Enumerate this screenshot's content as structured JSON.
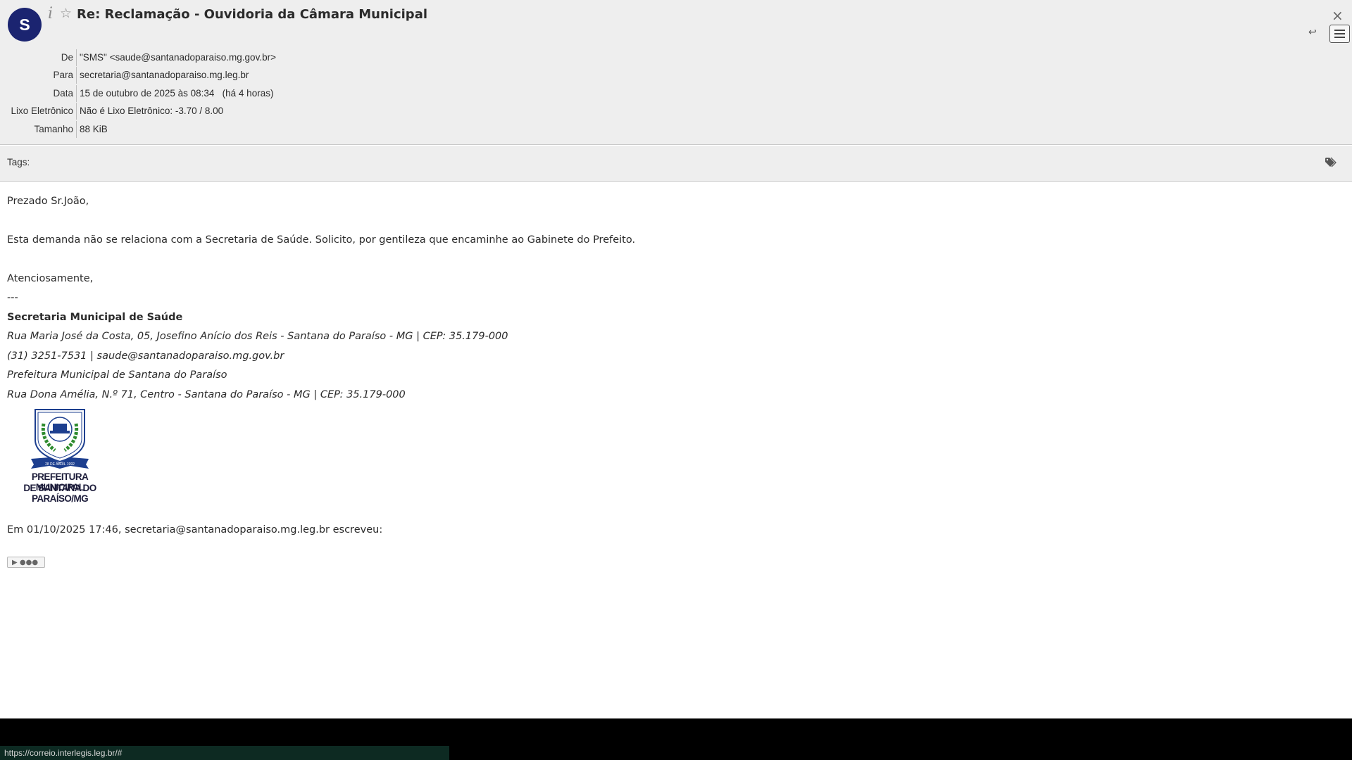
{
  "header": {
    "avatar_letter": "S",
    "info_icon": "info-icon",
    "star_icon": "star-icon",
    "subject": "Re: Reclamação - Ouvidoria da Câmara Municipal",
    "close_glyph": "×",
    "reply_glyph": "↩",
    "fields": [
      {
        "label": "De",
        "value": "\"SMS\" <saude@santanadoparaiso.mg.gov.br>"
      },
      {
        "label": "Para",
        "value": "secretaria@santanadoparaiso.mg.leg.br"
      },
      {
        "label": "Data",
        "value": "15 de outubro de 2025 às 08:34   (há 4 horas)"
      },
      {
        "label": "Lixo Eletrônico",
        "value": "Não é Lixo Eletrônico: -3.70 / 8.00"
      },
      {
        "label": "Tamanho",
        "value": "88 KiB"
      }
    ]
  },
  "tags": {
    "label": "Tags:",
    "icon": "tags-icon"
  },
  "message": {
    "greeting": "Prezado Sr.João,",
    "paragraph": "Esta demanda não se relaciona com a Secretaria de Saúde. Solicito, por gentileza que encaminhe ao Gabinete do Prefeito.",
    "closing": "Atenciosamente,",
    "separator": "---",
    "signature": {
      "org": "Secretaria Municipal de Saúde",
      "address1": "Rua Maria José da Costa, 05, Josefino Anício dos Reis - Santana do Paraíso - MG | CEP: 35.179-000",
      "contact": "(31) 3251-7531 | saude@santanadoparaiso.mg.gov.br",
      "prefeitura": "Prefeitura Municipal de Santana do Paraíso",
      "address2": "Rua Dona Amélia, N.º 71, Centro - Santana do Paraíso - MG | CEP: 35.179-000"
    },
    "logo": {
      "line1": "PREFEITURA MUNICIPAL",
      "line2": "DE SANTANA DO PARAÍSO/MG",
      "ribbon": "28 DE ABRIL 1992"
    },
    "quote_header": "Em 01/10/2025 17:46, secretaria@santanadoparaiso.mg.leg.br escreveu:",
    "expand_label": "▶ ●●●"
  },
  "status": {
    "url": "https://correio.interlegis.leg.br/#"
  },
  "colors": {
    "avatar": "#1b2470",
    "header_bg": "#eeeeee",
    "status_bg": "#0d2a22"
  }
}
